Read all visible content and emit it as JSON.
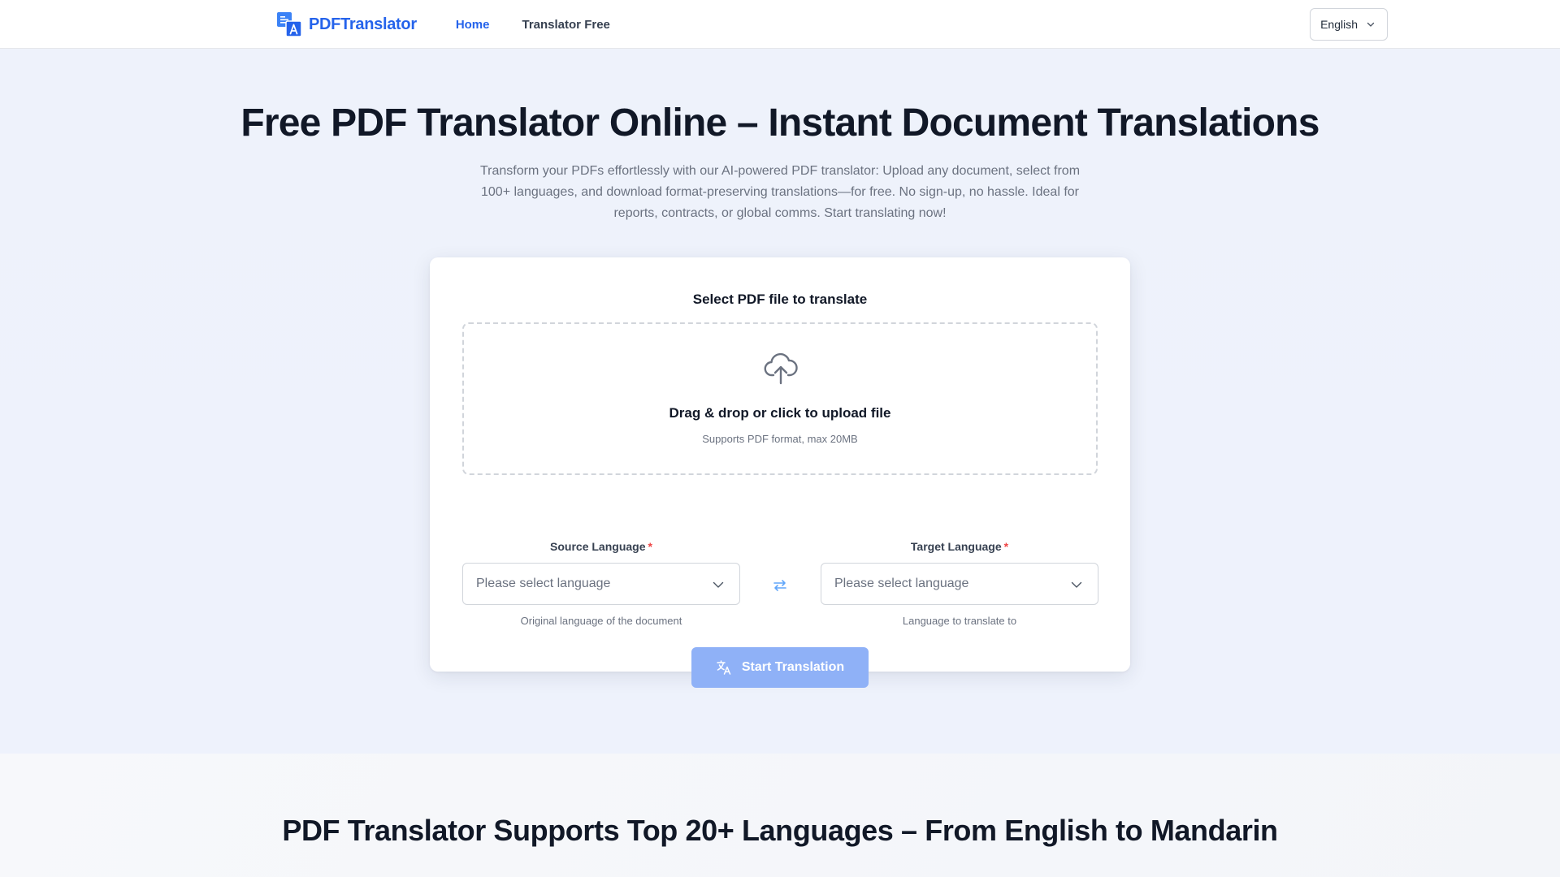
{
  "nav": {
    "brand": "PDFTranslator",
    "links": [
      {
        "label": "Home",
        "active": true
      },
      {
        "label": "Translator Free",
        "active": false
      }
    ],
    "language": "English"
  },
  "hero": {
    "title": "Free PDF Translator Online – Instant Document Translations",
    "description": "Transform your PDFs effortlessly with our AI-powered PDF translator: Upload any document, select from 100+ languages, and download format-preserving translations—for free. No sign-up, no hassle. Ideal for reports, contracts, or global comms. Start translating now!"
  },
  "card": {
    "title": "Select PDF file to translate",
    "dropzone": {
      "icon": "cloud-upload-icon",
      "main": "Drag & drop or click to upload file",
      "sub": "Supports PDF format, max 20MB"
    },
    "source": {
      "label": "Source Language",
      "required_mark": "*",
      "placeholder": "Please select language",
      "hint": "Original language of the document"
    },
    "target": {
      "label": "Target Language",
      "required_mark": "*",
      "placeholder": "Please select language",
      "hint": "Language to translate to"
    },
    "swap_icon": "swap-icon",
    "start_button": "Start Translation"
  },
  "section2": {
    "title": "PDF Translator Supports Top 20+ Languages – From English to Mandarin"
  },
  "colors": {
    "primary": "#2563eb",
    "button_disabled": "#8fb1f7",
    "required": "#ef4444",
    "hero_bg": "#eef2fb"
  }
}
